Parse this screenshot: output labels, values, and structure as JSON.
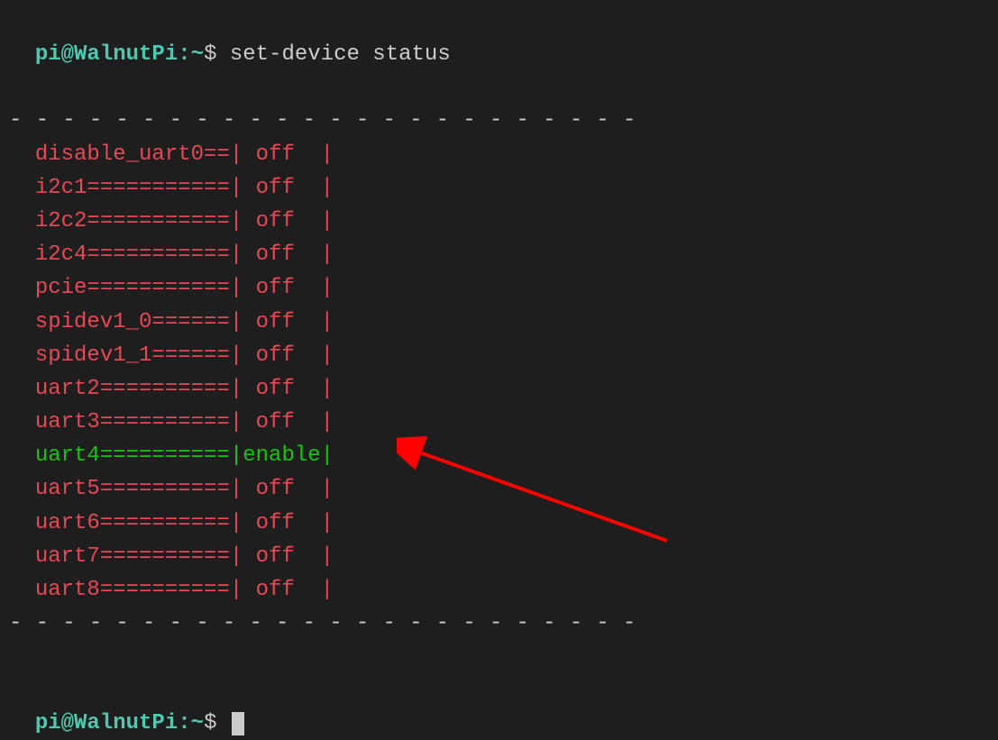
{
  "prompt": {
    "user_host": "pi@WalnutPi",
    "path": "~",
    "symbol": "$"
  },
  "command": "set-device status",
  "dash_border": "- - - - - - - - - - - - - - - - - - - - - - - -",
  "devices": [
    {
      "label": "disable_uart0==|",
      "status": " off  |",
      "enabled": false
    },
    {
      "label": "i2c1===========|",
      "status": " off  |",
      "enabled": false
    },
    {
      "label": "i2c2===========|",
      "status": " off  |",
      "enabled": false
    },
    {
      "label": "i2c4===========|",
      "status": " off  |",
      "enabled": false
    },
    {
      "label": "pcie===========|",
      "status": " off  |",
      "enabled": false
    },
    {
      "label": "spidev1_0======|",
      "status": " off  |",
      "enabled": false
    },
    {
      "label": "spidev1_1======|",
      "status": " off  |",
      "enabled": false
    },
    {
      "label": "uart2==========|",
      "status": " off  |",
      "enabled": false
    },
    {
      "label": "uart3==========|",
      "status": " off  |",
      "enabled": false
    },
    {
      "label": "uart4==========|",
      "status": "enable|",
      "enabled": true
    },
    {
      "label": "uart5==========|",
      "status": " off  |",
      "enabled": false
    },
    {
      "label": "uart6==========|",
      "status": " off  |",
      "enabled": false
    },
    {
      "label": "uart7==========|",
      "status": " off  |",
      "enabled": false
    },
    {
      "label": "uart8==========|",
      "status": " off  |",
      "enabled": false
    }
  ],
  "annotation": {
    "arrow_color": "#ff0000"
  }
}
